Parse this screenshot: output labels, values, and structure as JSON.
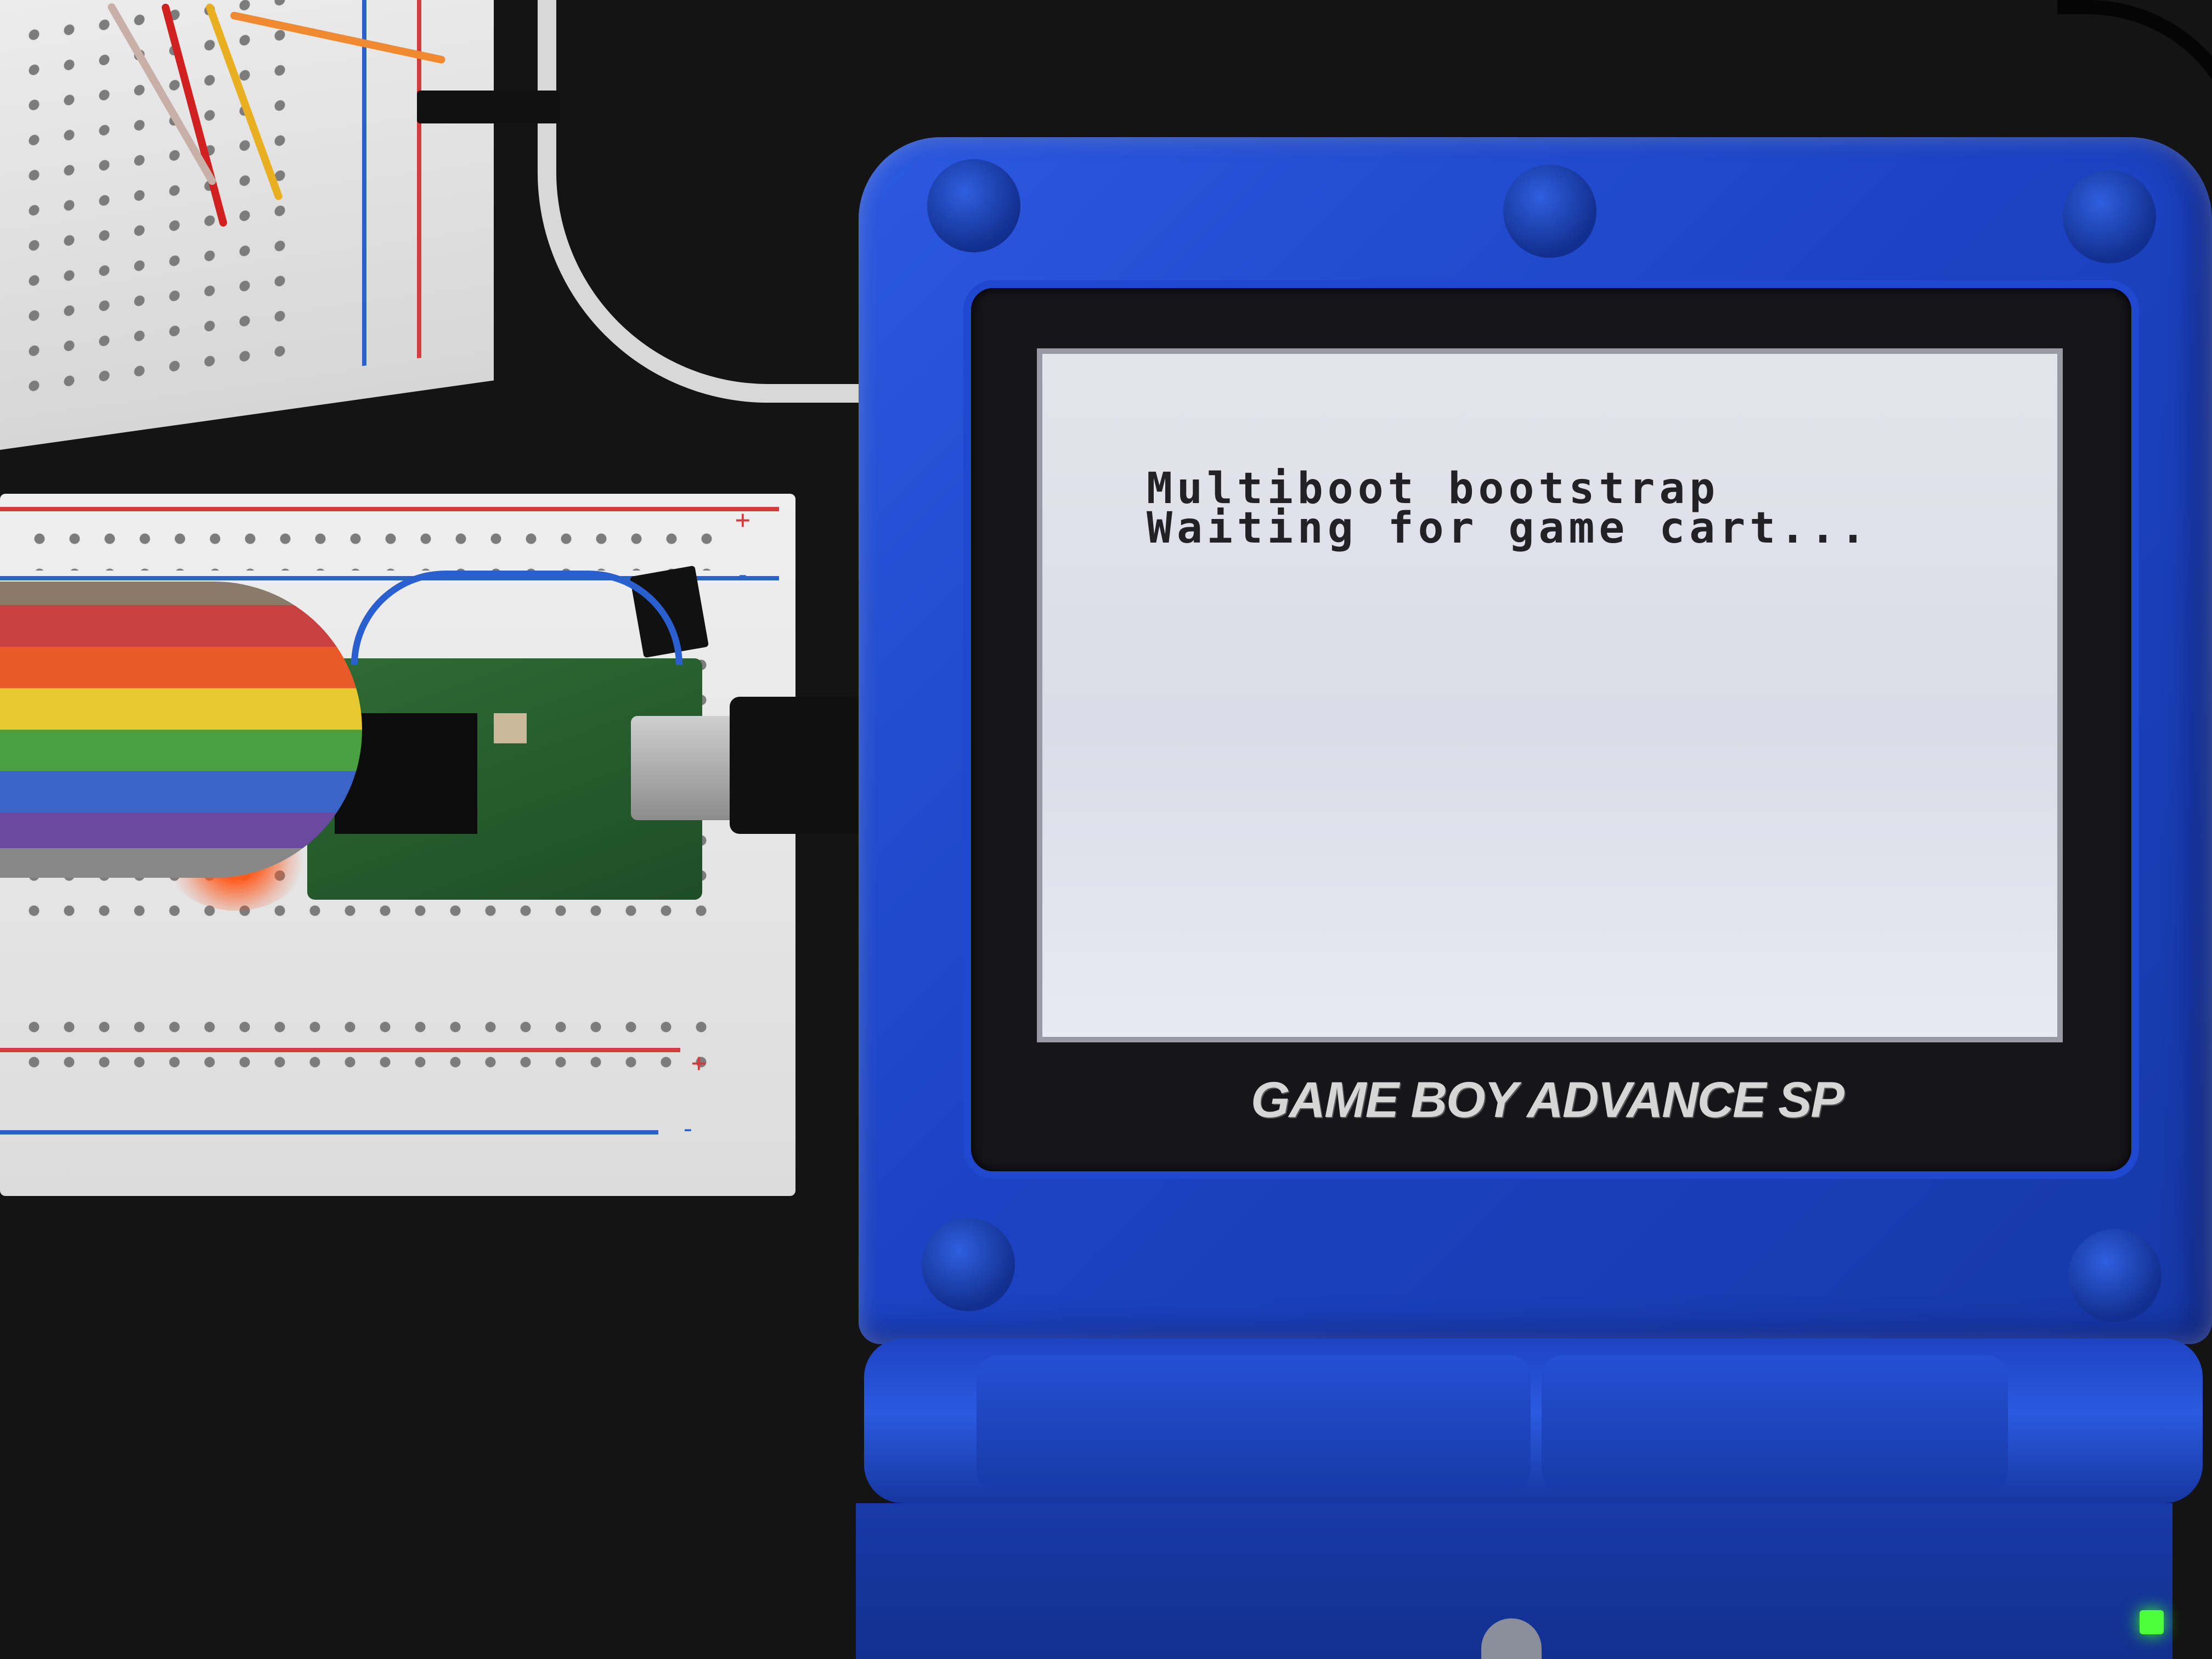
{
  "device": {
    "brand_logo": "GAME BOY ADVANCE SP",
    "body_color": "#1f46c9",
    "power_led_color": "#4dff3a"
  },
  "screen": {
    "line1": "Multiboot bootstrap",
    "line2": "Waiting for game cart...",
    "text_color": "#222226",
    "background_color": "#e2e2ec"
  },
  "breadboard": {
    "rail_plus": "+",
    "rail_minus": "-"
  }
}
